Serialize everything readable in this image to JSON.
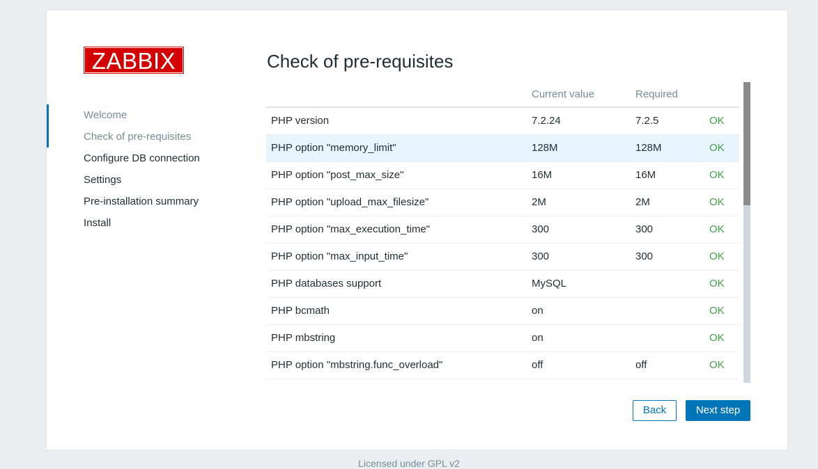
{
  "logo": {
    "text": "ZABBIX"
  },
  "nav": {
    "items": [
      {
        "label": "Welcome",
        "state": "done"
      },
      {
        "label": "Check of pre-requisites",
        "state": "active"
      },
      {
        "label": "Configure DB connection",
        "state": "todo"
      },
      {
        "label": "Settings",
        "state": "todo"
      },
      {
        "label": "Pre-installation summary",
        "state": "todo"
      },
      {
        "label": "Install",
        "state": "todo"
      }
    ]
  },
  "main": {
    "title": "Check of pre-requisites",
    "columns": [
      "",
      "Current value",
      "Required",
      ""
    ],
    "rows": [
      {
        "name": "PHP version",
        "current": "7.2.24",
        "required": "7.2.5",
        "status": "OK"
      },
      {
        "name": "PHP option \"memory_limit\"",
        "current": "128M",
        "required": "128M",
        "status": "OK"
      },
      {
        "name": "PHP option \"post_max_size\"",
        "current": "16M",
        "required": "16M",
        "status": "OK"
      },
      {
        "name": "PHP option \"upload_max_filesize\"",
        "current": "2M",
        "required": "2M",
        "status": "OK"
      },
      {
        "name": "PHP option \"max_execution_time\"",
        "current": "300",
        "required": "300",
        "status": "OK"
      },
      {
        "name": "PHP option \"max_input_time\"",
        "current": "300",
        "required": "300",
        "status": "OK"
      },
      {
        "name": "PHP databases support",
        "current": "MySQL",
        "required": "",
        "status": "OK"
      },
      {
        "name": "PHP bcmath",
        "current": "on",
        "required": "",
        "status": "OK"
      },
      {
        "name": "PHP mbstring",
        "current": "on",
        "required": "",
        "status": "OK"
      },
      {
        "name": "PHP option \"mbstring.func_overload\"",
        "current": "off",
        "required": "off",
        "status": "OK"
      }
    ],
    "highlighted_row": 1,
    "scroll_fraction_visible": 0.41
  },
  "buttons": {
    "back": "Back",
    "next": "Next step"
  },
  "footer": {
    "text": "Licensed under GPL v2"
  },
  "colors": {
    "brand": "#d40000",
    "accent": "#0275b8",
    "ok": "#429e47",
    "highlight": "#e8f5ff"
  }
}
